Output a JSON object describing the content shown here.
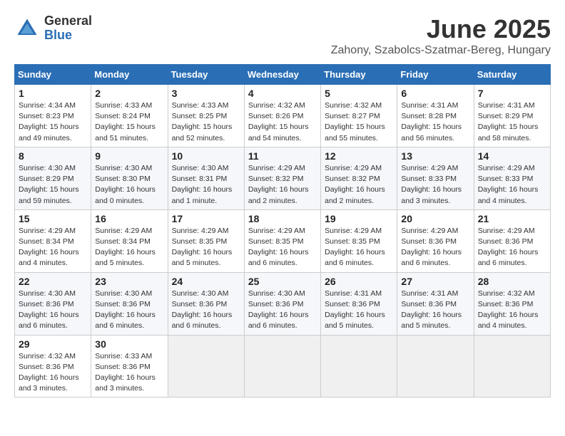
{
  "header": {
    "logo_general": "General",
    "logo_blue": "Blue",
    "title": "June 2025",
    "subtitle": "Zahony, Szabolcs-Szatmar-Bereg, Hungary"
  },
  "days_of_week": [
    "Sunday",
    "Monday",
    "Tuesday",
    "Wednesday",
    "Thursday",
    "Friday",
    "Saturday"
  ],
  "weeks": [
    [
      {
        "day": "1",
        "sunrise": "4:34 AM",
        "sunset": "8:23 PM",
        "daylight": "15 hours and 49 minutes."
      },
      {
        "day": "2",
        "sunrise": "4:33 AM",
        "sunset": "8:24 PM",
        "daylight": "15 hours and 51 minutes."
      },
      {
        "day": "3",
        "sunrise": "4:33 AM",
        "sunset": "8:25 PM",
        "daylight": "15 hours and 52 minutes."
      },
      {
        "day": "4",
        "sunrise": "4:32 AM",
        "sunset": "8:26 PM",
        "daylight": "15 hours and 54 minutes."
      },
      {
        "day": "5",
        "sunrise": "4:32 AM",
        "sunset": "8:27 PM",
        "daylight": "15 hours and 55 minutes."
      },
      {
        "day": "6",
        "sunrise": "4:31 AM",
        "sunset": "8:28 PM",
        "daylight": "15 hours and 56 minutes."
      },
      {
        "day": "7",
        "sunrise": "4:31 AM",
        "sunset": "8:29 PM",
        "daylight": "15 hours and 58 minutes."
      }
    ],
    [
      {
        "day": "8",
        "sunrise": "4:30 AM",
        "sunset": "8:29 PM",
        "daylight": "15 hours and 59 minutes."
      },
      {
        "day": "9",
        "sunrise": "4:30 AM",
        "sunset": "8:30 PM",
        "daylight": "16 hours and 0 minutes."
      },
      {
        "day": "10",
        "sunrise": "4:30 AM",
        "sunset": "8:31 PM",
        "daylight": "16 hours and 1 minute."
      },
      {
        "day": "11",
        "sunrise": "4:29 AM",
        "sunset": "8:32 PM",
        "daylight": "16 hours and 2 minutes."
      },
      {
        "day": "12",
        "sunrise": "4:29 AM",
        "sunset": "8:32 PM",
        "daylight": "16 hours and 2 minutes."
      },
      {
        "day": "13",
        "sunrise": "4:29 AM",
        "sunset": "8:33 PM",
        "daylight": "16 hours and 3 minutes."
      },
      {
        "day": "14",
        "sunrise": "4:29 AM",
        "sunset": "8:33 PM",
        "daylight": "16 hours and 4 minutes."
      }
    ],
    [
      {
        "day": "15",
        "sunrise": "4:29 AM",
        "sunset": "8:34 PM",
        "daylight": "16 hours and 4 minutes."
      },
      {
        "day": "16",
        "sunrise": "4:29 AM",
        "sunset": "8:34 PM",
        "daylight": "16 hours and 5 minutes."
      },
      {
        "day": "17",
        "sunrise": "4:29 AM",
        "sunset": "8:35 PM",
        "daylight": "16 hours and 5 minutes."
      },
      {
        "day": "18",
        "sunrise": "4:29 AM",
        "sunset": "8:35 PM",
        "daylight": "16 hours and 6 minutes."
      },
      {
        "day": "19",
        "sunrise": "4:29 AM",
        "sunset": "8:35 PM",
        "daylight": "16 hours and 6 minutes."
      },
      {
        "day": "20",
        "sunrise": "4:29 AM",
        "sunset": "8:36 PM",
        "daylight": "16 hours and 6 minutes."
      },
      {
        "day": "21",
        "sunrise": "4:29 AM",
        "sunset": "8:36 PM",
        "daylight": "16 hours and 6 minutes."
      }
    ],
    [
      {
        "day": "22",
        "sunrise": "4:30 AM",
        "sunset": "8:36 PM",
        "daylight": "16 hours and 6 minutes."
      },
      {
        "day": "23",
        "sunrise": "4:30 AM",
        "sunset": "8:36 PM",
        "daylight": "16 hours and 6 minutes."
      },
      {
        "day": "24",
        "sunrise": "4:30 AM",
        "sunset": "8:36 PM",
        "daylight": "16 hours and 6 minutes."
      },
      {
        "day": "25",
        "sunrise": "4:30 AM",
        "sunset": "8:36 PM",
        "daylight": "16 hours and 6 minutes."
      },
      {
        "day": "26",
        "sunrise": "4:31 AM",
        "sunset": "8:36 PM",
        "daylight": "16 hours and 5 minutes."
      },
      {
        "day": "27",
        "sunrise": "4:31 AM",
        "sunset": "8:36 PM",
        "daylight": "16 hours and 5 minutes."
      },
      {
        "day": "28",
        "sunrise": "4:32 AM",
        "sunset": "8:36 PM",
        "daylight": "16 hours and 4 minutes."
      }
    ],
    [
      {
        "day": "29",
        "sunrise": "4:32 AM",
        "sunset": "8:36 PM",
        "daylight": "16 hours and 3 minutes."
      },
      {
        "day": "30",
        "sunrise": "4:33 AM",
        "sunset": "8:36 PM",
        "daylight": "16 hours and 3 minutes."
      },
      null,
      null,
      null,
      null,
      null
    ]
  ]
}
